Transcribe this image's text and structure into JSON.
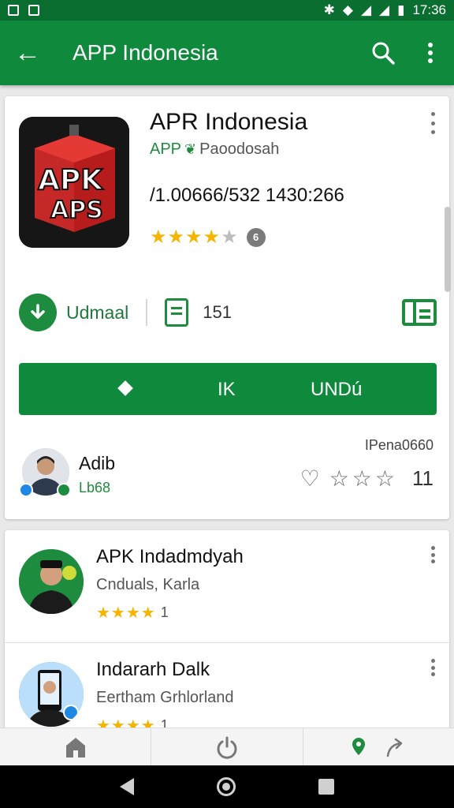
{
  "status_bar": {
    "time": "17:36",
    "left_icons": [
      "notification-icon",
      "gallery-icon"
    ],
    "right_icons": [
      "bluetooth-icon",
      "wifi-icon",
      "signal-icon",
      "signal-icon",
      "battery-icon"
    ]
  },
  "app_bar": {
    "title": "APP Indonesia",
    "back_icon": "arrow-left-icon",
    "search_icon": "search-icon",
    "more_icon": "more-vert-icon"
  },
  "app": {
    "title": "APR Indonesia",
    "developer_prefix": "APP",
    "developer_name": "Paoodosah",
    "version": "/1.00666/532 1430:266",
    "rating_stars": 3.5,
    "rating_badge": "6",
    "icon_text_top": "APK",
    "icon_text_bottom": "APS"
  },
  "actions": {
    "download_label": "Udmaal",
    "review_count": "151",
    "install_diamond_label": "",
    "install_left_label": "IK",
    "install_right_label": "UNDú"
  },
  "review": {
    "top_label": "IPena0660",
    "name": "Adib",
    "sub": "Lb68",
    "score": "11",
    "stars": 3
  },
  "list": [
    {
      "title": "APK Indadmdyah",
      "subtitle": "Cnduals, Karla",
      "rating_stars": 4,
      "rating_count": "1",
      "avatar_color": "#1e8c3e"
    },
    {
      "title": "Indararh Dalk",
      "subtitle": "Eertham Grhlorland",
      "rating_stars": 4,
      "rating_count": "1",
      "avatar_color": "#1e88e5"
    }
  ],
  "colors": {
    "primary": "#0f8a3c",
    "primary_dark": "#0a6e30",
    "star": "#f5b400",
    "icon_red": "#d32f2f"
  }
}
